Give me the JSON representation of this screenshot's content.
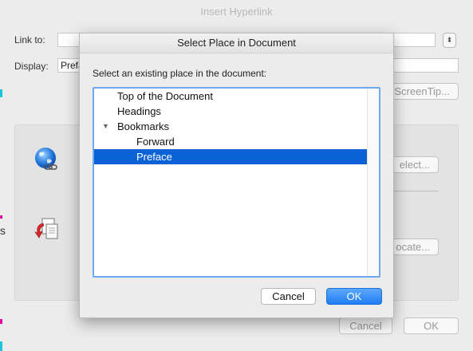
{
  "parent_dialog": {
    "title": "Insert Hyperlink",
    "link_to_label": "Link to:",
    "link_to_value": "",
    "display_label": "Display:",
    "display_value": "Prefa",
    "screentip_button": "ScreenTip...",
    "select_button": "elect...",
    "locate_button": "ocate...",
    "cancel_button": "Cancel",
    "ok_button": "OK",
    "edge_text": "s"
  },
  "icons": {
    "web_page": "globe-link-icon",
    "this_document": "document-arrow-icon"
  },
  "colors": {
    "selection": "#0a62d6",
    "ok_button": "#1f7ef2",
    "focus_ring": "#6ea9f0"
  },
  "sheet": {
    "title": "Select Place in Document",
    "prompt": "Select an existing place in the document:",
    "items": [
      {
        "label": "Top of the Document",
        "selected": false
      },
      {
        "label": "Headings",
        "selected": false
      },
      {
        "label": "Bookmarks",
        "selected": false,
        "expanded": true
      },
      {
        "label": "Forward",
        "selected": false
      },
      {
        "label": "Preface",
        "selected": true
      }
    ],
    "cancel_label": "Cancel",
    "ok_label": "OK"
  }
}
